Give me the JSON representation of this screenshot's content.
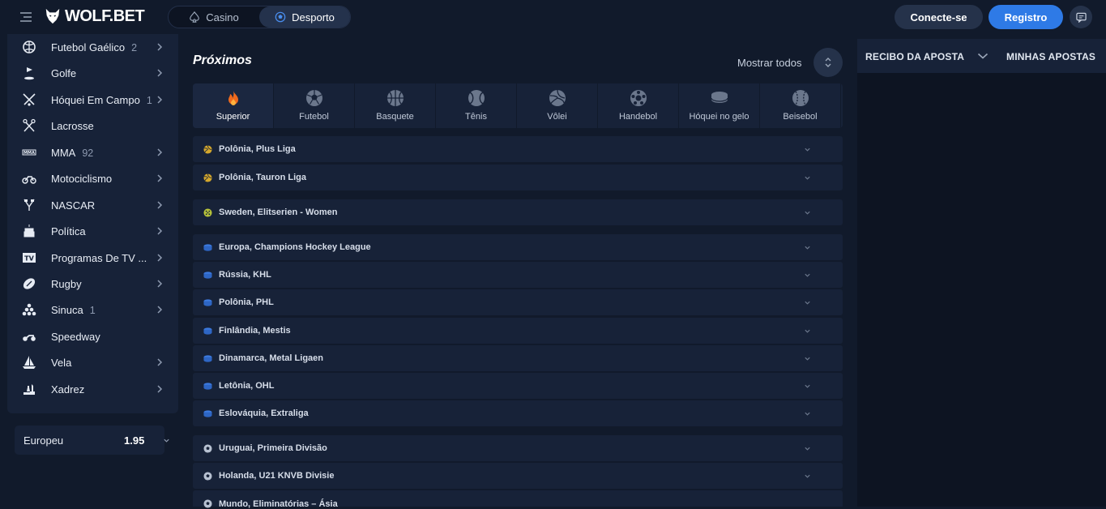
{
  "header": {
    "logo_text": "WOLF.BET",
    "tabs": [
      {
        "label": "Casino",
        "active": false
      },
      {
        "label": "Desporto",
        "active": true
      }
    ],
    "connect_label": "Conecte-se",
    "register_label": "Registro",
    "accent_color": "#2e7ae6"
  },
  "sidebar": {
    "items": [
      {
        "label": "Futebol Gaélico",
        "count": "2",
        "icon": "gaelic-football-icon",
        "chevron": true
      },
      {
        "label": "Golfe",
        "count": "",
        "icon": "golf-icon",
        "chevron": true
      },
      {
        "label": "Hóquei Em Campo",
        "count": "1",
        "icon": "field-hockey-icon",
        "chevron": true
      },
      {
        "label": "Lacrosse",
        "count": "",
        "icon": "lacrosse-icon",
        "chevron": false
      },
      {
        "label": "MMA",
        "count": "92",
        "icon": "mma-icon",
        "chevron": true
      },
      {
        "label": "Motociclismo",
        "count": "",
        "icon": "motorcycle-icon",
        "chevron": true
      },
      {
        "label": "NASCAR",
        "count": "",
        "icon": "nascar-icon",
        "chevron": true
      },
      {
        "label": "Política",
        "count": "",
        "icon": "politics-icon",
        "chevron": true
      },
      {
        "label": "Programas De TV ...",
        "count": "",
        "icon": "tv-icon",
        "chevron": true
      },
      {
        "label": "Rugby",
        "count": "",
        "icon": "rugby-icon",
        "chevron": true
      },
      {
        "label": "Sinuca",
        "count": "1",
        "icon": "snooker-icon",
        "chevron": true
      },
      {
        "label": "Speedway",
        "count": "",
        "icon": "speedway-icon",
        "chevron": false
      },
      {
        "label": "Vela",
        "count": "",
        "icon": "sailing-icon",
        "chevron": true
      },
      {
        "label": "Xadrez",
        "count": "",
        "icon": "chess-icon",
        "chevron": true
      }
    ],
    "odds_format": {
      "label": "Europeu",
      "value": "1.95"
    }
  },
  "main": {
    "title": "Próximos",
    "show_all_label": "Mostrar todos",
    "sports": [
      {
        "label": "Superior",
        "icon": "fire-icon",
        "active": true
      },
      {
        "label": "Futebol",
        "icon": "soccer-icon",
        "active": false
      },
      {
        "label": "Basquete",
        "icon": "basketball-icon",
        "active": false
      },
      {
        "label": "Tênis",
        "icon": "tennis-icon",
        "active": false
      },
      {
        "label": "Vôlei",
        "icon": "volleyball-icon",
        "active": false
      },
      {
        "label": "Handebol",
        "icon": "handball-icon",
        "active": false
      },
      {
        "label": "Hóquei no gelo",
        "icon": "ice-hockey-icon",
        "active": false
      },
      {
        "label": "Beisebol",
        "icon": "baseball-icon",
        "active": false
      }
    ],
    "leagues": [
      {
        "name": "Polônia, Plus Liga",
        "icon": "volleyball-icon"
      },
      {
        "name": "Polônia, Tauron Liga",
        "icon": "volleyball-icon"
      },
      {
        "name": "Sweden, Elitserien - Women",
        "icon": "floorball-icon"
      },
      {
        "name": "Europa, Champions Hockey League",
        "icon": "ice-hockey-icon"
      },
      {
        "name": "Rússia, KHL",
        "icon": "ice-hockey-icon"
      },
      {
        "name": "Polônia, PHL",
        "icon": "ice-hockey-icon"
      },
      {
        "name": "Finlândia, Mestis",
        "icon": "ice-hockey-icon"
      },
      {
        "name": "Dinamarca, Metal Ligaen",
        "icon": "ice-hockey-icon"
      },
      {
        "name": "Letônia, OHL",
        "icon": "ice-hockey-icon"
      },
      {
        "name": "Eslováquia, Extraliga",
        "icon": "ice-hockey-icon"
      },
      {
        "name": "Uruguai, Primeira Divisão",
        "icon": "soccer-icon"
      },
      {
        "name": "Holanda, U21 KNVB Divisie",
        "icon": "soccer-icon"
      },
      {
        "name": "Mundo, Eliminatórias – Ásia",
        "icon": "soccer-icon"
      }
    ]
  },
  "betslip": {
    "tab1": "RECIBO DA APOSTA",
    "tab2": "MINHAS APOSTAS"
  }
}
